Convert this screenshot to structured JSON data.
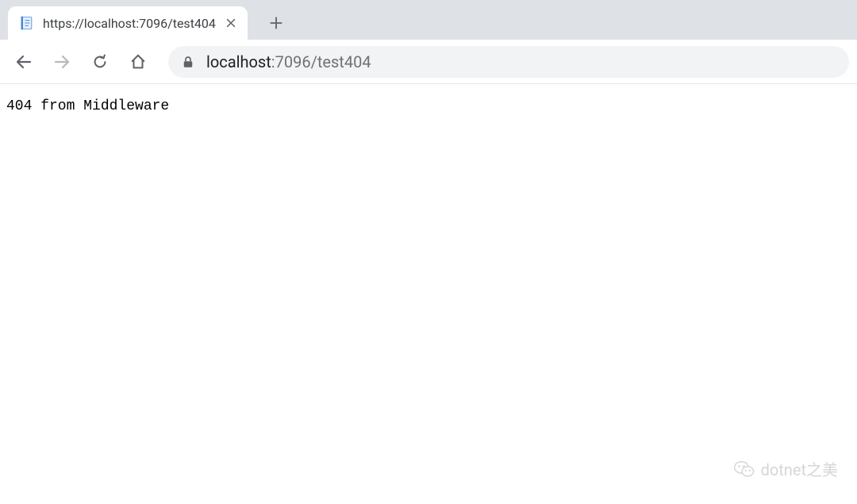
{
  "browser": {
    "tab": {
      "title": "https://localhost:7096/test404",
      "favicon": "document-icon"
    },
    "address": {
      "host": "localhost",
      "port_path": ":7096/test404"
    }
  },
  "page": {
    "body_text": "404 from Middleware"
  },
  "watermark": {
    "text": "dotnet之美"
  }
}
